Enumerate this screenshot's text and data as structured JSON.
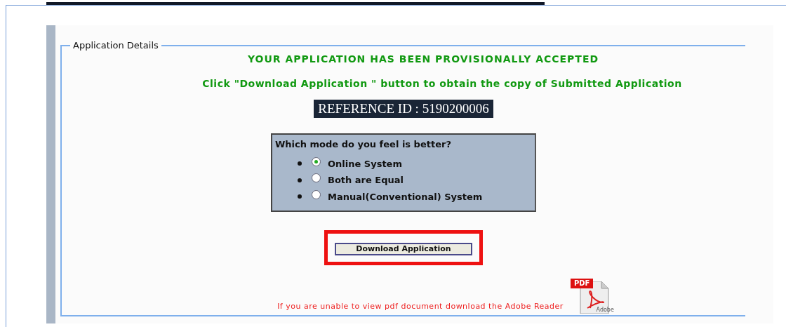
{
  "section": {
    "legend": "Application Details"
  },
  "status_message": "YOUR APPLICATION HAS BEEN PROVISIONALLY ACCEPTED",
  "instruction": "Click \"Download Application \" button to obtain the copy of Submitted Application",
  "reference": "REFERENCE ID : 5190200006",
  "poll": {
    "question": "Which mode do you feel is better?",
    "options": [
      {
        "label": "Online System",
        "selected": true
      },
      {
        "label": "Both are Equal",
        "selected": false
      },
      {
        "label": "Manual(Conventional) System",
        "selected": false
      }
    ]
  },
  "download_button": "Download Application",
  "footer_note": "If you are unable to view pdf document download the Adobe Reader",
  "pdf_icon": {
    "badge": "PDF",
    "caption": "Adobe"
  }
}
